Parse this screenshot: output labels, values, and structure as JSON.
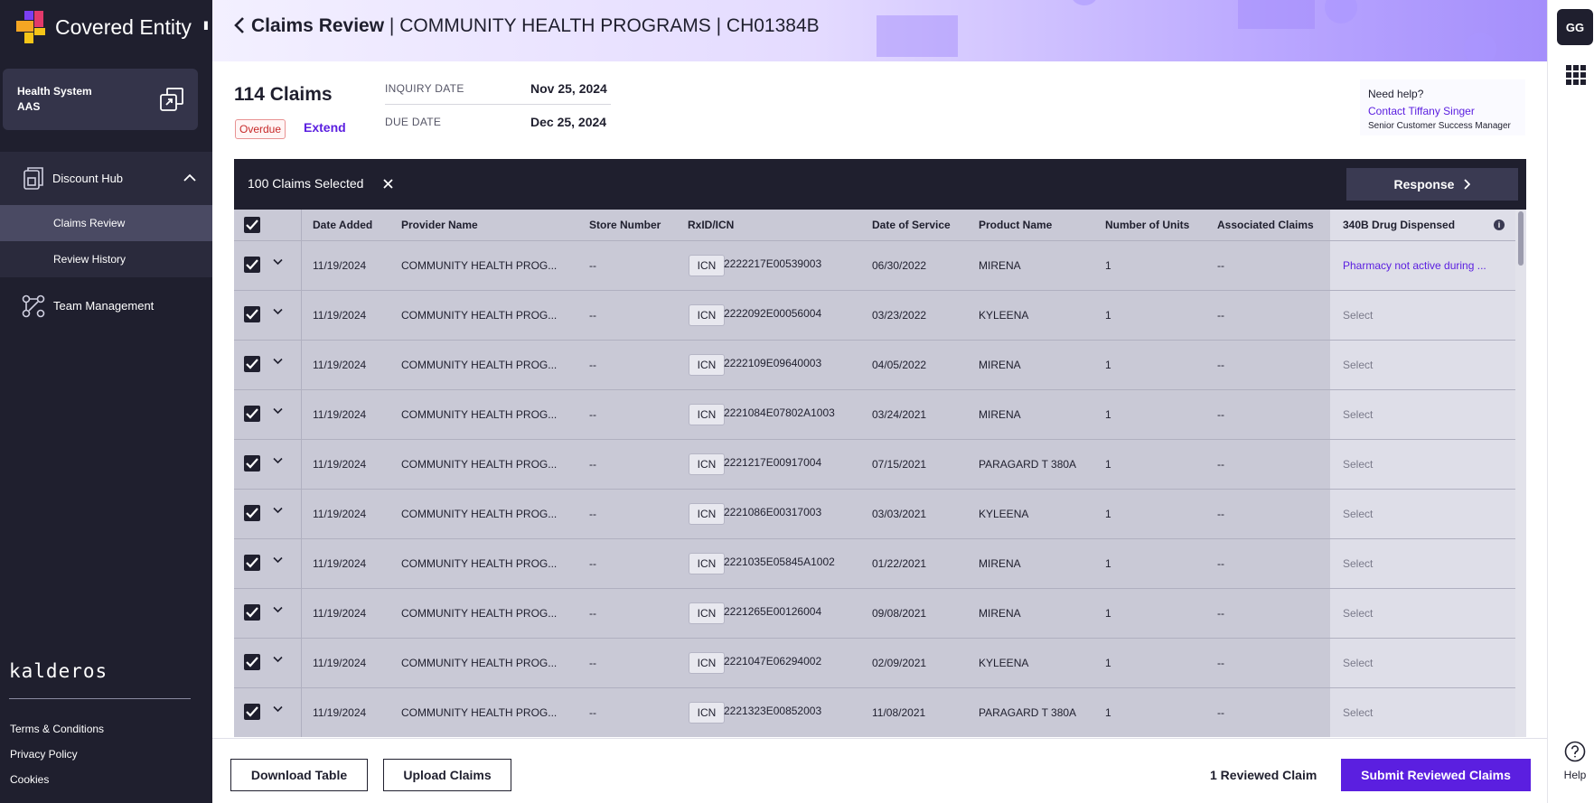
{
  "app": {
    "brand_name": "Covered Entity",
    "collapse_label": "II"
  },
  "org": {
    "line1": "Health System",
    "line2": "AAS"
  },
  "sidebar": {
    "discount_hub": "Discount Hub",
    "claims_review": "Claims Review",
    "review_history": "Review History",
    "team_management": "Team Management",
    "company": "kalderos",
    "terms": "Terms & Conditions",
    "privacy": "Privacy Policy",
    "cookies": "Cookies"
  },
  "header": {
    "title_bold": "Claims Review",
    "title_rest": " | COMMUNITY HEALTH PROGRAMS | CH01384B"
  },
  "rail": {
    "avatar": "GG",
    "help": "Help"
  },
  "summary": {
    "claims_count": "114 Claims",
    "overdue": "Overdue",
    "extend": "Extend",
    "inquiry_label": "INQUIRY DATE",
    "inquiry_value": "Nov 25, 2024",
    "due_label": "DUE DATE",
    "due_value": "Dec 25, 2024"
  },
  "help_card": {
    "question": "Need help?",
    "contact": "Contact Tiffany Singer",
    "role": "Senior Customer Success Manager"
  },
  "selection": {
    "text": "100 Claims Selected",
    "response": "Response"
  },
  "table": {
    "headers": {
      "date_added": "Date Added",
      "provider": "Provider Name",
      "store": "Store Number",
      "rxid": "RxID/ICN",
      "dos": "Date of Service",
      "product": "Product Name",
      "units": "Number of Units",
      "associated": "Associated Claims",
      "drug": "340B Drug Dispensed"
    },
    "rows": [
      {
        "date_added": "11/19/2024",
        "provider": "COMMUNITY HEALTH PROG...",
        "store": "--",
        "badge": "ICN",
        "rxid": "2222217E00539003",
        "dos": "06/30/2022",
        "product": "MIRENA",
        "units": "1",
        "associated": "--",
        "drug": "Pharmacy not active during ..."
      },
      {
        "date_added": "11/19/2024",
        "provider": "COMMUNITY HEALTH PROG...",
        "store": "--",
        "badge": "ICN",
        "rxid": "2222092E00056004",
        "dos": "03/23/2022",
        "product": "KYLEENA",
        "units": "1",
        "associated": "--",
        "drug": "Select"
      },
      {
        "date_added": "11/19/2024",
        "provider": "COMMUNITY HEALTH PROG...",
        "store": "--",
        "badge": "ICN",
        "rxid": "2222109E09640003",
        "dos": "04/05/2022",
        "product": "MIRENA",
        "units": "1",
        "associated": "--",
        "drug": "Select"
      },
      {
        "date_added": "11/19/2024",
        "provider": "COMMUNITY HEALTH PROG...",
        "store": "--",
        "badge": "ICN",
        "rxid": "2221084E07802A1003",
        "dos": "03/24/2021",
        "product": "MIRENA",
        "units": "1",
        "associated": "--",
        "drug": "Select"
      },
      {
        "date_added": "11/19/2024",
        "provider": "COMMUNITY HEALTH PROG...",
        "store": "--",
        "badge": "ICN",
        "rxid": "2221217E00917004",
        "dos": "07/15/2021",
        "product": "PARAGARD T 380A",
        "units": "1",
        "associated": "--",
        "drug": "Select"
      },
      {
        "date_added": "11/19/2024",
        "provider": "COMMUNITY HEALTH PROG...",
        "store": "--",
        "badge": "ICN",
        "rxid": "2221086E00317003",
        "dos": "03/03/2021",
        "product": "KYLEENA",
        "units": "1",
        "associated": "--",
        "drug": "Select"
      },
      {
        "date_added": "11/19/2024",
        "provider": "COMMUNITY HEALTH PROG...",
        "store": "--",
        "badge": "ICN",
        "rxid": "2221035E05845A1002",
        "dos": "01/22/2021",
        "product": "MIRENA",
        "units": "1",
        "associated": "--",
        "drug": "Select"
      },
      {
        "date_added": "11/19/2024",
        "provider": "COMMUNITY HEALTH PROG...",
        "store": "--",
        "badge": "ICN",
        "rxid": "2221265E00126004",
        "dos": "09/08/2021",
        "product": "MIRENA",
        "units": "1",
        "associated": "--",
        "drug": "Select"
      },
      {
        "date_added": "11/19/2024",
        "provider": "COMMUNITY HEALTH PROG...",
        "store": "--",
        "badge": "ICN",
        "rxid": "2221047E06294002",
        "dos": "02/09/2021",
        "product": "KYLEENA",
        "units": "1",
        "associated": "--",
        "drug": "Select"
      },
      {
        "date_added": "11/19/2024",
        "provider": "COMMUNITY HEALTH PROG...",
        "store": "--",
        "badge": "ICN",
        "rxid": "2221323E00852003",
        "dos": "11/08/2021",
        "product": "PARAGARD T 380A",
        "units": "1",
        "associated": "--",
        "drug": "Select"
      }
    ]
  },
  "footer": {
    "download": "Download Table",
    "upload": "Upload Claims",
    "reviewed": "1 Reviewed Claim",
    "submit": "Submit Reviewed Claims"
  },
  "colors": {
    "sidebar_bg": "#1f1f2e",
    "accent": "#5b1fe0",
    "overdue": "#c62828",
    "row_bg": "#c9c9d6"
  }
}
